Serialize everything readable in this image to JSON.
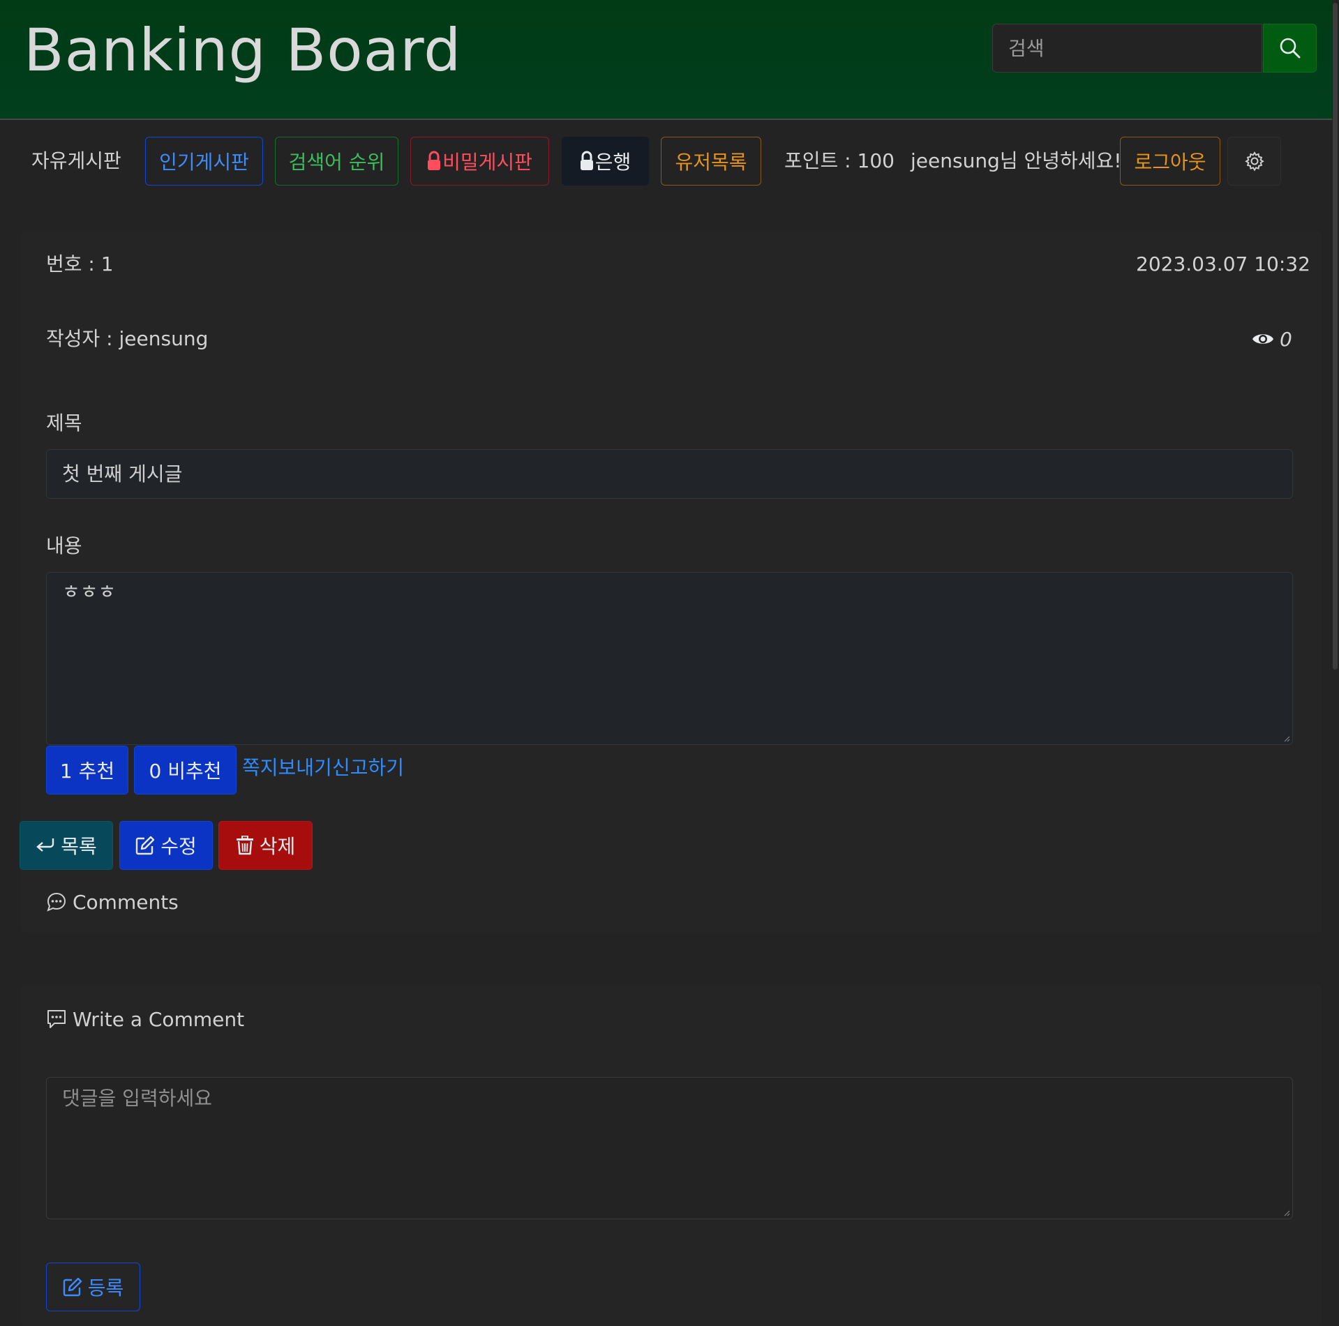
{
  "header": {
    "brand": "Banking Board",
    "search_placeholder": "검색"
  },
  "nav": {
    "free_board": "자유게시판",
    "popular_board": "인기게시판",
    "search_rank": "검색어 순위",
    "secret_board": "비밀게시판",
    "bank": "은행",
    "user_list": "유저목록",
    "points": "포인트 : 100",
    "greeting": "jeensung님 안녕하세요!",
    "logout": "로그아웃"
  },
  "post": {
    "number": "번호 : 1",
    "datetime": "2023.03.07 10:32",
    "author": "작성자 : jeensung",
    "views": "0",
    "title_label": "제목",
    "title_value": "첫 번째 게시글",
    "content_label": "내용",
    "content_value": "ㅎㅎㅎ",
    "like_label": "1 추천",
    "dislike_label": "0 비추천",
    "message_link": "쪽지보내기",
    "report_link": "신고하기",
    "list_btn": "목록",
    "edit_btn": "수정",
    "delete_btn": "삭제",
    "comments_heading": "Comments"
  },
  "comment_form": {
    "heading": "Write a Comment",
    "placeholder": "댓글을 입력하세요",
    "submit": "등록"
  },
  "colors": {
    "header_bg": "#013b16",
    "page_bg": "#232323",
    "primary": "#0b33c4",
    "danger": "#a80d0d"
  }
}
